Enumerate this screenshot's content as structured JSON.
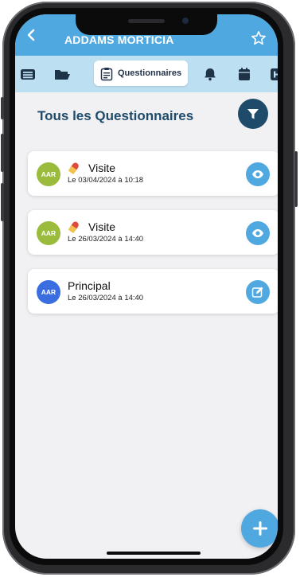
{
  "header": {
    "title": "ADDAMS MORTICIA"
  },
  "tabs": [
    {
      "icon": "list-icon",
      "active": false
    },
    {
      "icon": "folder-open-icon",
      "active": false
    },
    {
      "icon": "clipboard-icon",
      "label": "Questionnaires",
      "active": true
    },
    {
      "icon": "bell-icon",
      "active": false
    },
    {
      "icon": "calendar-icon",
      "active": false
    },
    {
      "icon": "h-box-icon",
      "active": false
    }
  ],
  "section": {
    "title": "Tous les Questionnaires"
  },
  "cards": [
    {
      "avatar": "AAR",
      "avatar_color": "#9bbb3c",
      "title": "Visite",
      "date": "Le 03/04/2024 à 10:18",
      "has_pill": true,
      "action": "eye-icon"
    },
    {
      "avatar": "AAR",
      "avatar_color": "#9bbb3c",
      "title": "Visite",
      "date": "Le 26/03/2024 à 14:40",
      "has_pill": true,
      "action": "eye-icon"
    },
    {
      "avatar": "AAR",
      "avatar_color": "#3a6ee0",
      "title": "Principal",
      "date": "Le 26/03/2024 à 14:40",
      "has_pill": false,
      "action": "edit-icon"
    }
  ],
  "colors": {
    "accent": "#4fa9e0",
    "tabbar": "#bcdff2",
    "dark_blue": "#1f4b6b"
  }
}
